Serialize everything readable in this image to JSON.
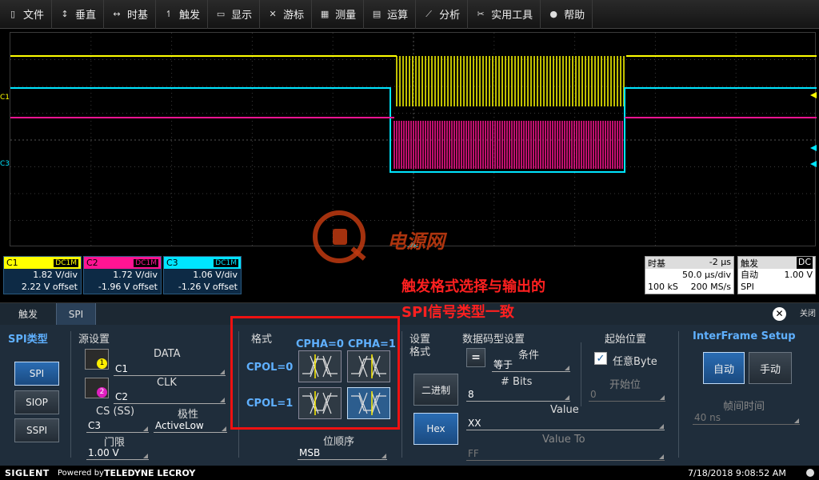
{
  "menu": [
    {
      "icon": "file-icon",
      "glyph": "▯",
      "label": "文件"
    },
    {
      "icon": "vertical-icon",
      "glyph": "↕",
      "label": "垂直"
    },
    {
      "icon": "timebase-icon",
      "glyph": "↔",
      "label": "时基"
    },
    {
      "icon": "trigger-icon",
      "glyph": "↿",
      "label": "触发"
    },
    {
      "icon": "display-icon",
      "glyph": "▭",
      "label": "显示"
    },
    {
      "icon": "cursor-icon",
      "glyph": "✕",
      "label": "游标"
    },
    {
      "icon": "measure-icon",
      "glyph": "▦",
      "label": "测量"
    },
    {
      "icon": "math-icon",
      "glyph": "▤",
      "label": "运算"
    },
    {
      "icon": "analysis-icon",
      "glyph": "⟋",
      "label": "分析"
    },
    {
      "icon": "tools-icon",
      "glyph": "✂",
      "label": "实用工具"
    },
    {
      "icon": "help-icon",
      "glyph": "●",
      "label": "帮助"
    }
  ],
  "channels": [
    {
      "name": "C1",
      "coupling": "DC1M",
      "vdiv": "1.82 V/div",
      "offset": "2.22 V offset",
      "color": "#ffff00"
    },
    {
      "name": "C2",
      "coupling": "DC1M",
      "vdiv": "1.72 V/div",
      "offset": "-1.96 V offset",
      "color": "#ff1493"
    },
    {
      "name": "C3",
      "coupling": "DC1M",
      "vdiv": "1.06 V/div",
      "offset": "-1.26 V offset",
      "color": "#00e5ff"
    }
  ],
  "trace_markers": {
    "c1": "C1",
    "c3": "C3"
  },
  "timebase": {
    "title": "时基",
    "delay": "-2 µs",
    "tdiv": "50.0 µs/div",
    "samples": "100 kS",
    "rate": "200 MS/s"
  },
  "trigger": {
    "title": "触发",
    "coupling": "DC",
    "mode": "自动",
    "level": "1.00 V",
    "type": "SPI"
  },
  "watermark": {
    "text": "电源网"
  },
  "annotation": {
    "line1": "触发格式选择与输出的",
    "line2": "SPI信号类型一致"
  },
  "tabs": {
    "trigger": "触发",
    "spi": "SPI",
    "close": "关闭"
  },
  "spi_type": {
    "title": "SPI类型",
    "options": [
      "SPI",
      "SIOP",
      "SSPI"
    ]
  },
  "source": {
    "title": "源设置",
    "data_label": "DATA",
    "data_value": "C1",
    "clk_label": "CLK",
    "clk_value": "C2",
    "cs_label": "CS (SS)",
    "cs_value": "C3",
    "polarity_label": "极性",
    "polarity_value": "ActiveLow",
    "threshold_label": "门限",
    "threshold_value": "1.00 V",
    "probe1": "1",
    "probe2": "2"
  },
  "format": {
    "title": "格式",
    "cpha0": "CPHA=0",
    "cpha1": "CPHA=1",
    "cpol0": "CPOL=0",
    "cpol1": "CPOL=1",
    "bit_order_label": "位顺序",
    "bit_order_value": "MSB"
  },
  "setting_format": {
    "title1": "设置",
    "title2": "格式",
    "binary": "二进制",
    "hex": "Hex"
  },
  "pattern": {
    "title": "数据码型设置",
    "condition_label": "条件",
    "condition_value": "等于",
    "eq_symbol": "=",
    "bits_label": "# Bits",
    "bits_value": "8",
    "value_label": "Value",
    "value_value": "XX",
    "value_to_label": "Value To",
    "value_to_value": "FF"
  },
  "start_pos": {
    "title": "起始位置",
    "any_byte": "任意Byte",
    "start_bit_label": "开始位",
    "start_bit_value": "0"
  },
  "interframe": {
    "title": "InterFrame Setup",
    "auto": "自动",
    "manual": "手动",
    "frame_time_label": "帧间时间",
    "frame_time_value": "40 ns"
  },
  "footer": {
    "brand": "SIGLENT",
    "powered": "Powered by",
    "partner": "TELEDYNE LECROY",
    "datetime": "7/18/2018 9:08:52 AM"
  }
}
